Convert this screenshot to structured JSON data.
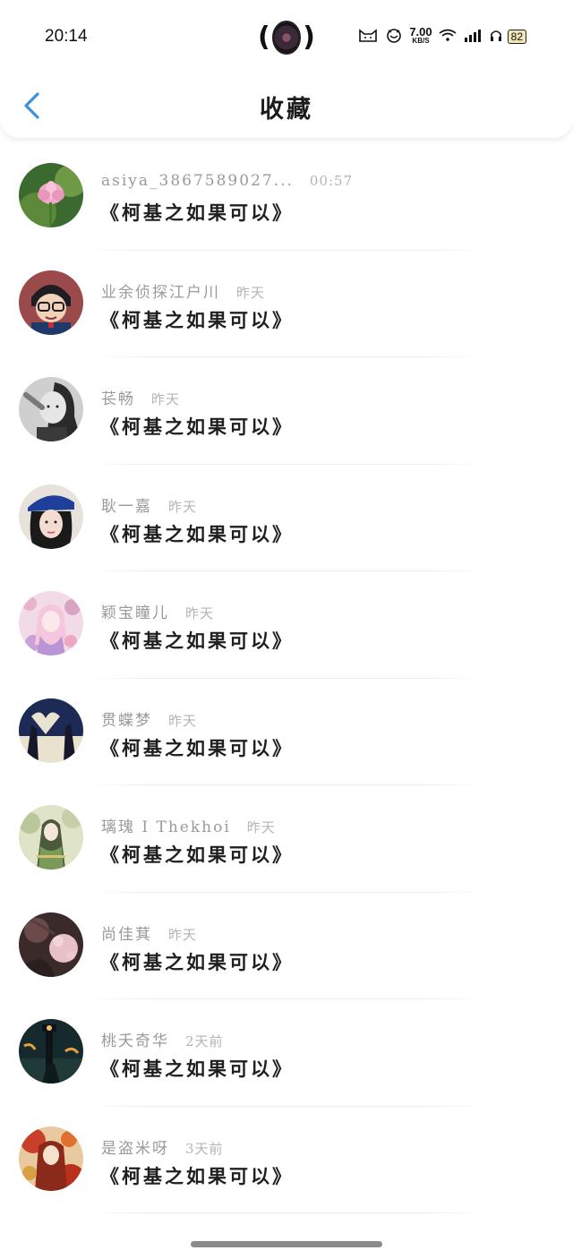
{
  "status_bar": {
    "time": "20:14",
    "net_speed": "7.00",
    "net_unit": "KB/S",
    "battery": "82"
  },
  "header": {
    "title": "收藏"
  },
  "items": [
    {
      "name": "asiya_3867589027...",
      "time": "00:57",
      "text": "《柯基之如果可以》"
    },
    {
      "name": "业余侦探江户川",
      "time": "昨天",
      "text": "《柯基之如果可以》"
    },
    {
      "name": "苌畅",
      "time": "昨天",
      "text": "《柯基之如果可以》"
    },
    {
      "name": "耿一嘉",
      "time": "昨天",
      "text": "《柯基之如果可以》"
    },
    {
      "name": "颖宝瞳儿",
      "time": "昨天",
      "text": "《柯基之如果可以》"
    },
    {
      "name": "贯蝶梦",
      "time": "昨天",
      "text": "《柯基之如果可以》"
    },
    {
      "name": "璃瑰 I Thekhoi",
      "time": "昨天",
      "text": "《柯基之如果可以》"
    },
    {
      "name": "尚佳萁",
      "time": "昨天",
      "text": "《柯基之如果可以》"
    },
    {
      "name": "桃夭奇华",
      "time": "2天前",
      "text": "《柯基之如果可以》"
    },
    {
      "name": "是盗米呀",
      "time": "3天前",
      "text": "《柯基之如果可以》"
    }
  ],
  "colors": {
    "accent": "#3d8fe0",
    "name_gray": "#9a9a9a",
    "text_dark": "#1f1f1f"
  }
}
